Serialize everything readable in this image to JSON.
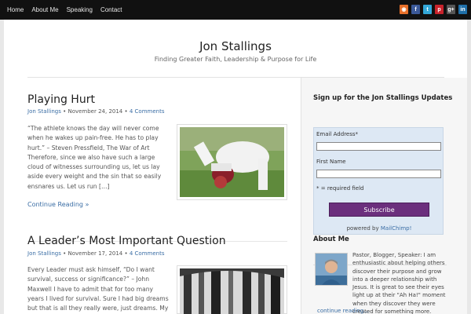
{
  "nav": {
    "items": [
      "Home",
      "About Me",
      "Speaking",
      "Contact"
    ]
  },
  "social": [
    {
      "icon": "rss-icon",
      "glyph": "◉",
      "color": "#e8702a"
    },
    {
      "icon": "facebook-icon",
      "glyph": "f",
      "color": "#3b5998"
    },
    {
      "icon": "twitter-icon",
      "glyph": "t",
      "color": "#33a8d8"
    },
    {
      "icon": "pinterest-icon",
      "glyph": "p",
      "color": "#c8232c"
    },
    {
      "icon": "googleplus-icon",
      "glyph": "g+",
      "color": "#555555"
    },
    {
      "icon": "linkedin-icon",
      "glyph": "in",
      "color": "#1f6fa8"
    }
  ],
  "site": {
    "title": "Jon Stallings",
    "description": "Finding Greater Faith, Leadership & Purpose for Life"
  },
  "posts": [
    {
      "title": "Playing Hurt",
      "author": "Jon Stallings",
      "date": "November 24, 2014",
      "comments": "4 Comments",
      "excerpt": "“The athlete knows the day will never come when he wakes up pain-free. He has to play hurt.” – Steven Pressfield, The War of Art Therefore, since we also have such a large cloud of witnesses surrounding us, let us lay aside every weight and the sin that so easily ensnares us. Let us run […]",
      "more": "Continue Reading »"
    },
    {
      "title": "A Leader’s Most Important Question",
      "author": "Jon Stallings",
      "date": "November 17, 2014",
      "comments": "4 Comments",
      "excerpt": "Every Leader must ask himself, “Do I want survival, success or significance?” – John Maxwell   I have to admit that for too many years I lived for survival. Sure I had big dreams but that is all they really were, just dreams. My"
    }
  ],
  "signup": {
    "title": "Sign up for the Jon Stallings Updates",
    "email_label": "Email Address*",
    "first_name_label": "First Name",
    "required_note": "* = required field",
    "button": "Subscribe",
    "powered_by": "powered by",
    "powered_link": "MailChimp!"
  },
  "about": {
    "title": "About Me",
    "text": "Pastor, Blogger, Speaker: I am enthusiastic about helping others discover their purpose and grow into a deeper relationship with Jesus. It is great to see their eyes light up at their \"Ah Ha!\" moment when they discover they were created for something more.",
    "link": "continue reading..."
  },
  "colors": {
    "accent": "#3b6ea5",
    "button": "#6b2f7d",
    "widget_bg": "#dde8f4"
  }
}
